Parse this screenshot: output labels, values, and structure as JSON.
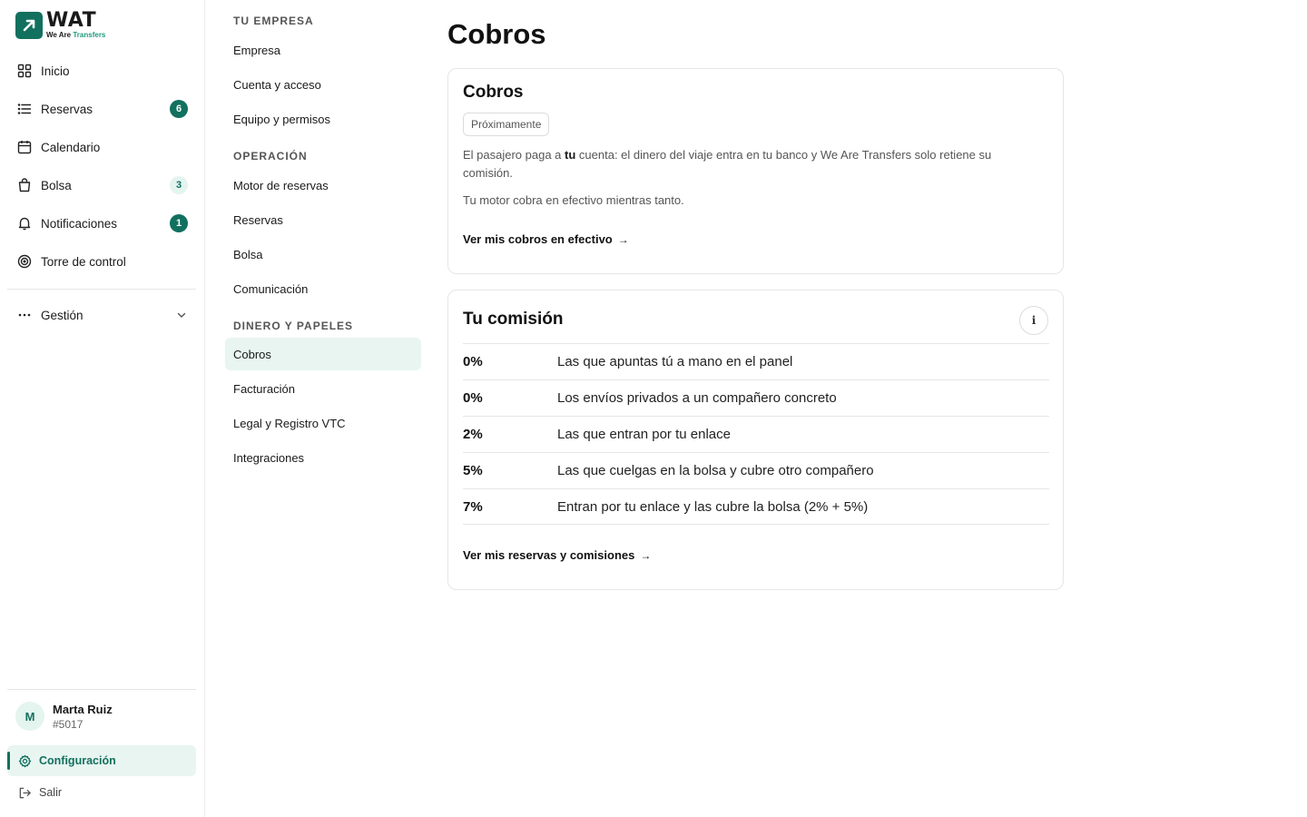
{
  "brand": {
    "name": "WAT",
    "tagline_a": "We Are",
    "tagline_b": "Transfers",
    "color": "#12705e"
  },
  "sidebar": {
    "items": [
      {
        "label": "Inicio",
        "icon": "grid-icon"
      },
      {
        "label": "Reservas",
        "icon": "list-icon",
        "badge": "6",
        "badge_style": "dark"
      },
      {
        "label": "Calendario",
        "icon": "calendar-icon"
      },
      {
        "label": "Bolsa",
        "icon": "bag-icon",
        "badge": "3",
        "badge_style": "light"
      },
      {
        "label": "Notificaciones",
        "icon": "bell-icon",
        "badge": "1",
        "badge_style": "dark"
      },
      {
        "label": "Torre de control",
        "icon": "target-icon"
      }
    ],
    "gestion": {
      "label": "Gestión",
      "icon": "more-dots-icon"
    },
    "user": {
      "initial": "M",
      "name": "Marta Ruiz",
      "id": "#5017"
    },
    "config_label": "Configuración",
    "logout_label": "Salir"
  },
  "subnav": {
    "sections": [
      {
        "title": "TU EMPRESA",
        "items": [
          "Empresa",
          "Cuenta y acceso",
          "Equipo y permisos"
        ]
      },
      {
        "title": "OPERACIÓN",
        "items": [
          "Motor de reservas",
          "Reservas",
          "Bolsa",
          "Comunicación"
        ]
      },
      {
        "title": "DINERO Y PAPELES",
        "items": [
          "Cobros",
          "Facturación",
          "Legal y Registro VTC",
          "Integraciones"
        ]
      }
    ],
    "active": "Cobros"
  },
  "main": {
    "page_title": "Cobros",
    "cobros_card": {
      "title": "Cobros",
      "badge": "Próximamente",
      "para1_before": "El pasajero paga a ",
      "para1_bold": "tu",
      "para1_after": " cuenta: el dinero del viaje entra en tu banco y We Are Transfers solo retiene su comisión.",
      "para2": "Tu motor cobra en efectivo mientras tanto.",
      "link": "Ver mis cobros en efectivo",
      "arrow": "→"
    },
    "comision_card": {
      "title": "Tu comisión",
      "info": "i",
      "rows": [
        {
          "pct": "0%",
          "desc": "Las que apuntas tú a mano en el panel"
        },
        {
          "pct": "0%",
          "desc": "Los envíos privados a un compañero concreto"
        },
        {
          "pct": "2%",
          "desc": "Las que entran por tu enlace"
        },
        {
          "pct": "5%",
          "desc": "Las que cuelgas en la bolsa y cubre otro compañero"
        },
        {
          "pct": "7%",
          "desc": "Entran por tu enlace y las cubre la bolsa (2% + 5%)"
        }
      ],
      "link": "Ver mis reservas y comisiones",
      "arrow": "→"
    }
  }
}
